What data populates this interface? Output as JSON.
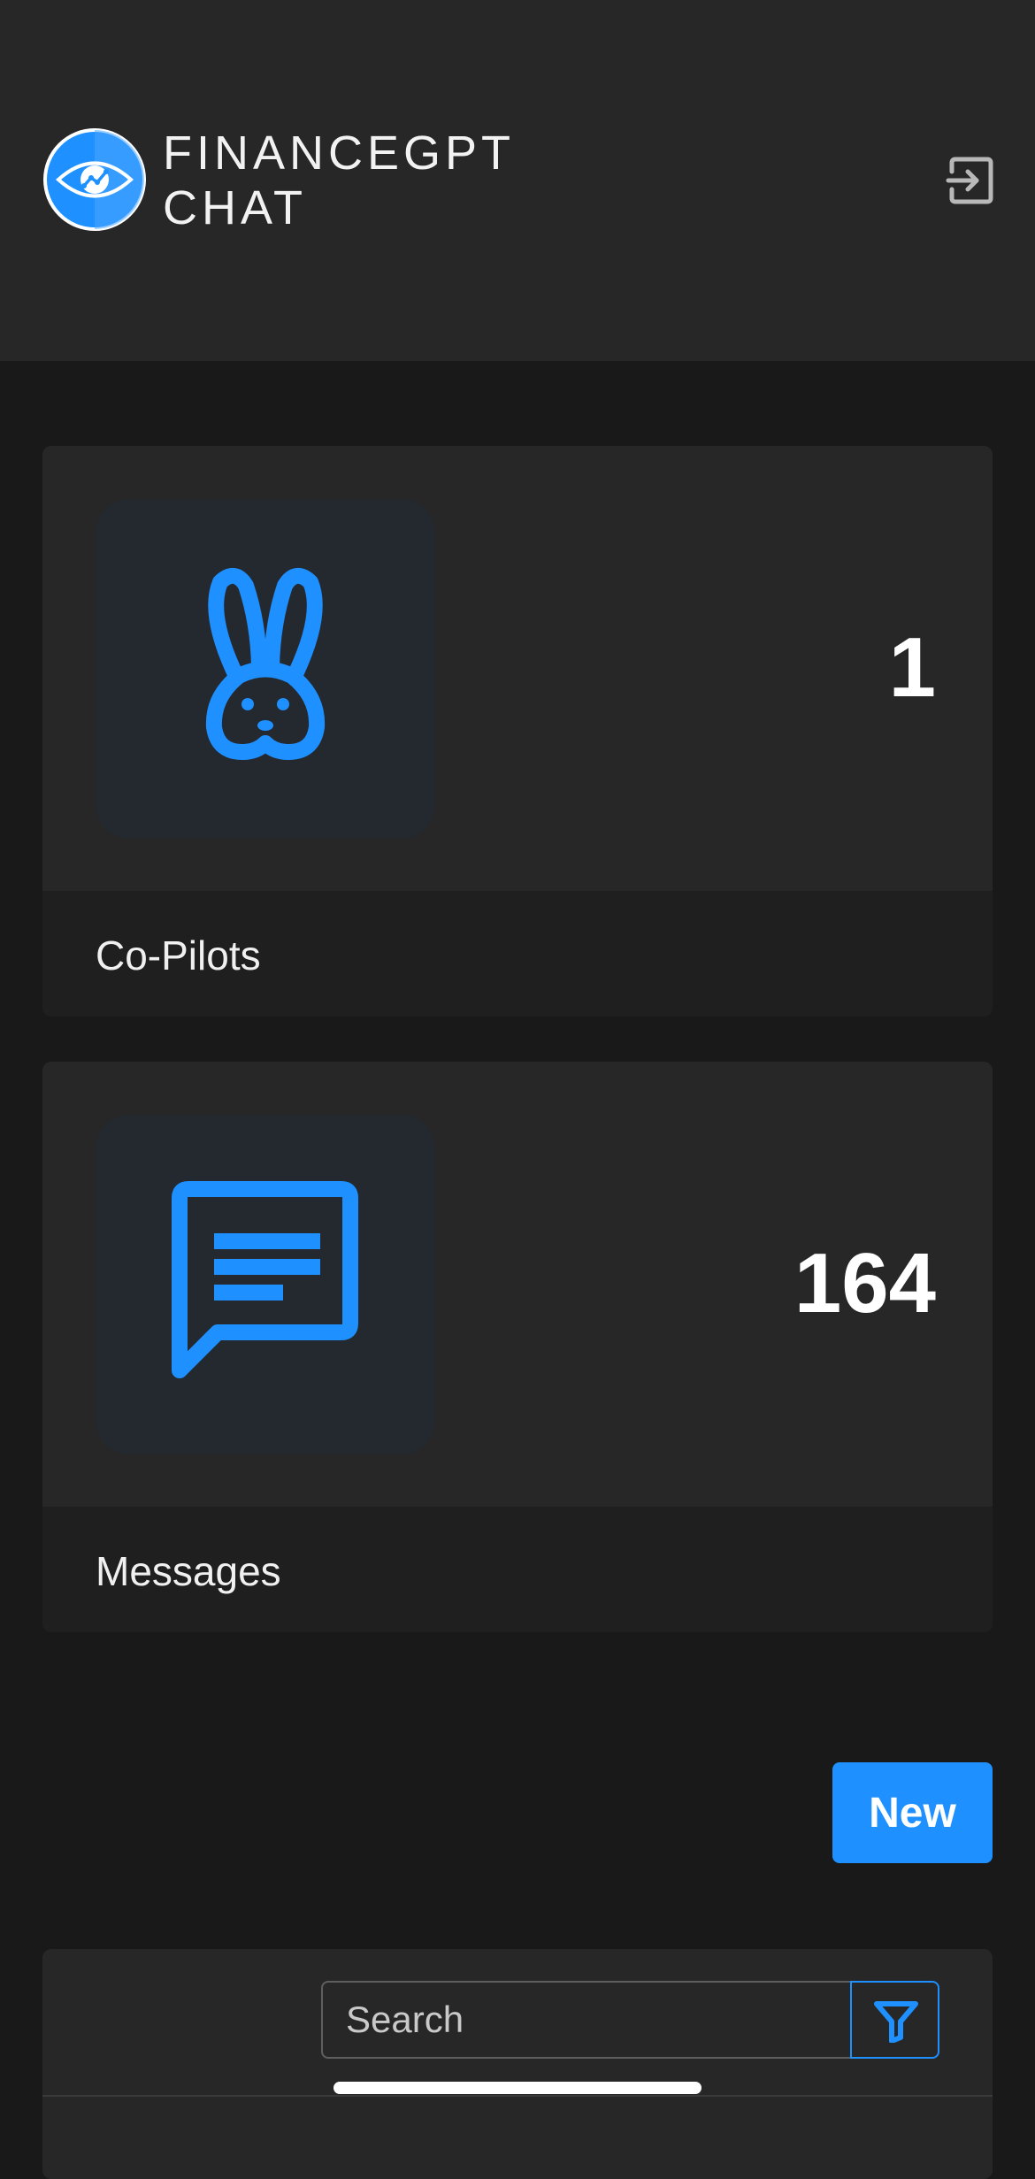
{
  "header": {
    "brand_line1": "FINANCEGPT",
    "brand_line2": "CHAT",
    "logo_icon": "eye-chart-logo",
    "logout_icon": "logout-icon"
  },
  "stats": [
    {
      "count": "1",
      "label": "Co-Pilots",
      "icon": "rabbit-icon"
    },
    {
      "count": "164",
      "label": "Messages",
      "icon": "message-icon"
    }
  ],
  "actions": {
    "new_label": "New"
  },
  "search": {
    "placeholder": "Search",
    "value": ""
  },
  "colors": {
    "accent": "#1e90ff",
    "header_bg": "#272727",
    "page_bg": "#191919",
    "card_bg": "#272727",
    "card_footer_bg": "#1f1f1f",
    "icon_tile_bg": "#24292f"
  }
}
